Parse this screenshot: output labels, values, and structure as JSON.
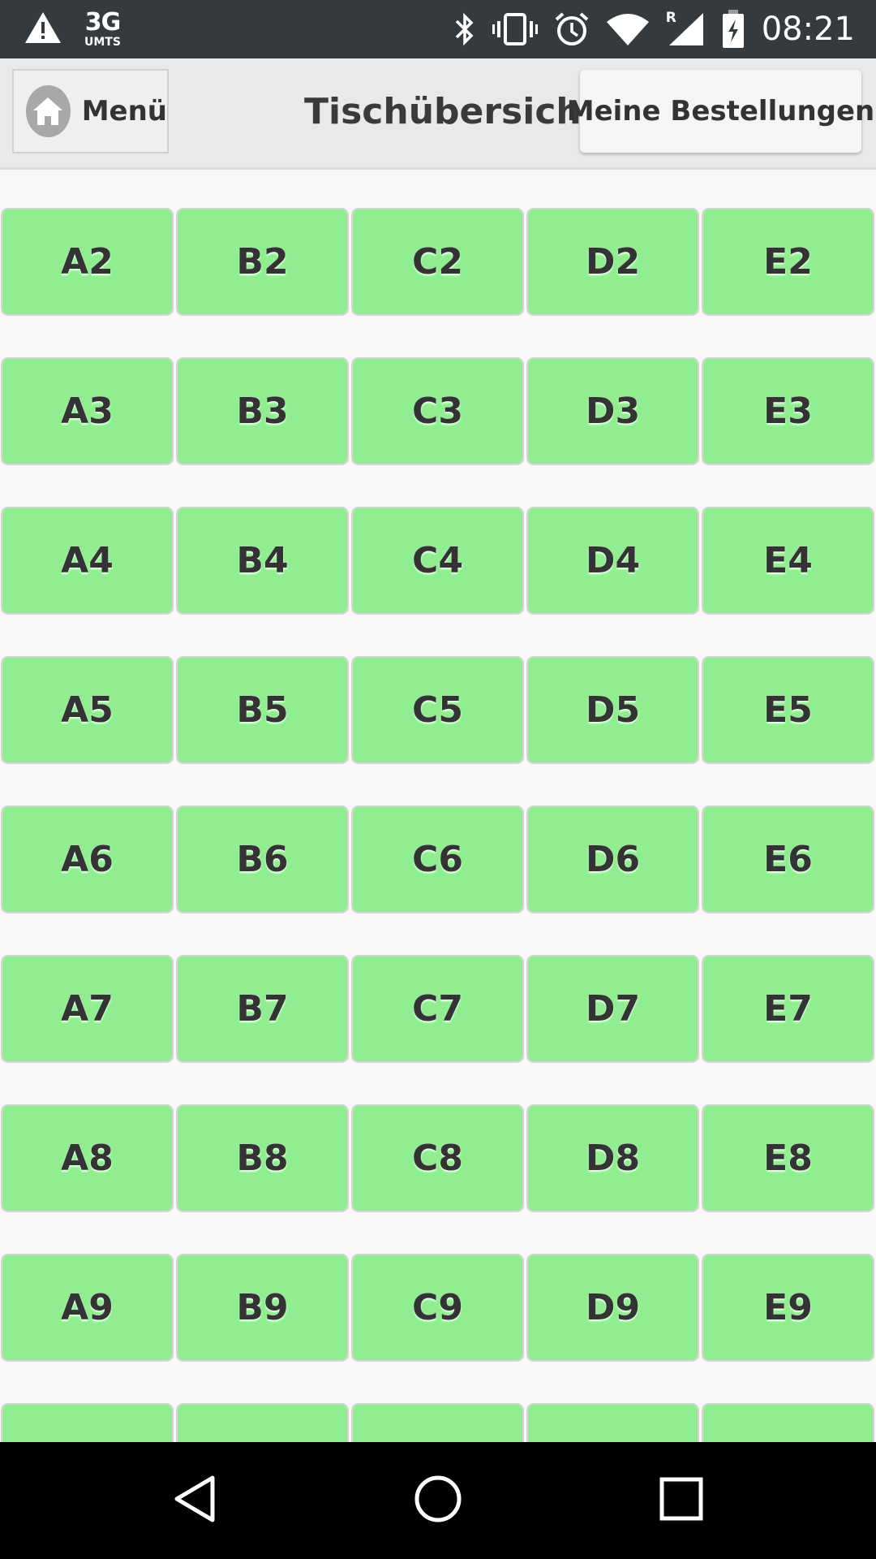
{
  "status_bar": {
    "network_type": "3G",
    "network_sub": "UMTS",
    "roaming_indicator": "R",
    "time": "08:21",
    "icons": [
      "warning-icon",
      "bluetooth-icon",
      "vibrate-icon",
      "alarm-icon",
      "wifi-icon",
      "signal-icon",
      "battery-icon"
    ]
  },
  "header": {
    "menu_label": "Menü",
    "title": "Tischübersicht",
    "orders_label": "Meine Bestellungen"
  },
  "tables": {
    "rows": [
      [
        "A2",
        "B2",
        "C2",
        "D2",
        "E2"
      ],
      [
        "A3",
        "B3",
        "C3",
        "D3",
        "E3"
      ],
      [
        "A4",
        "B4",
        "C4",
        "D4",
        "E4"
      ],
      [
        "A5",
        "B5",
        "C5",
        "D5",
        "E5"
      ],
      [
        "A6",
        "B6",
        "C6",
        "D6",
        "E6"
      ],
      [
        "A7",
        "B7",
        "C7",
        "D7",
        "E7"
      ],
      [
        "A8",
        "B8",
        "C8",
        "D8",
        "E8"
      ],
      [
        "A9",
        "B9",
        "C9",
        "D9",
        "E9"
      ],
      [
        "",
        "",
        "",
        "",
        ""
      ]
    ]
  },
  "colors": {
    "tile_green": "#90ee90",
    "status_bar": "#353a3f",
    "app_bar": "#e9e9e9"
  }
}
